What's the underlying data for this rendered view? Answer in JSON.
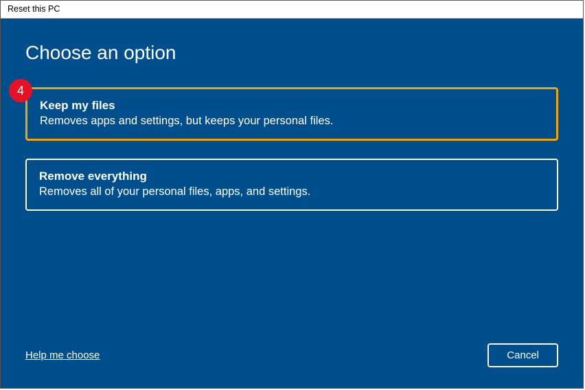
{
  "window": {
    "title": "Reset this PC"
  },
  "heading": "Choose an option",
  "badge": "4",
  "options": [
    {
      "title": "Keep my files",
      "description": "Removes apps and settings, but keeps your personal files."
    },
    {
      "title": "Remove everything",
      "description": "Removes all of your personal files, apps, and settings."
    }
  ],
  "footer": {
    "help_link": "Help me choose",
    "cancel": "Cancel"
  }
}
